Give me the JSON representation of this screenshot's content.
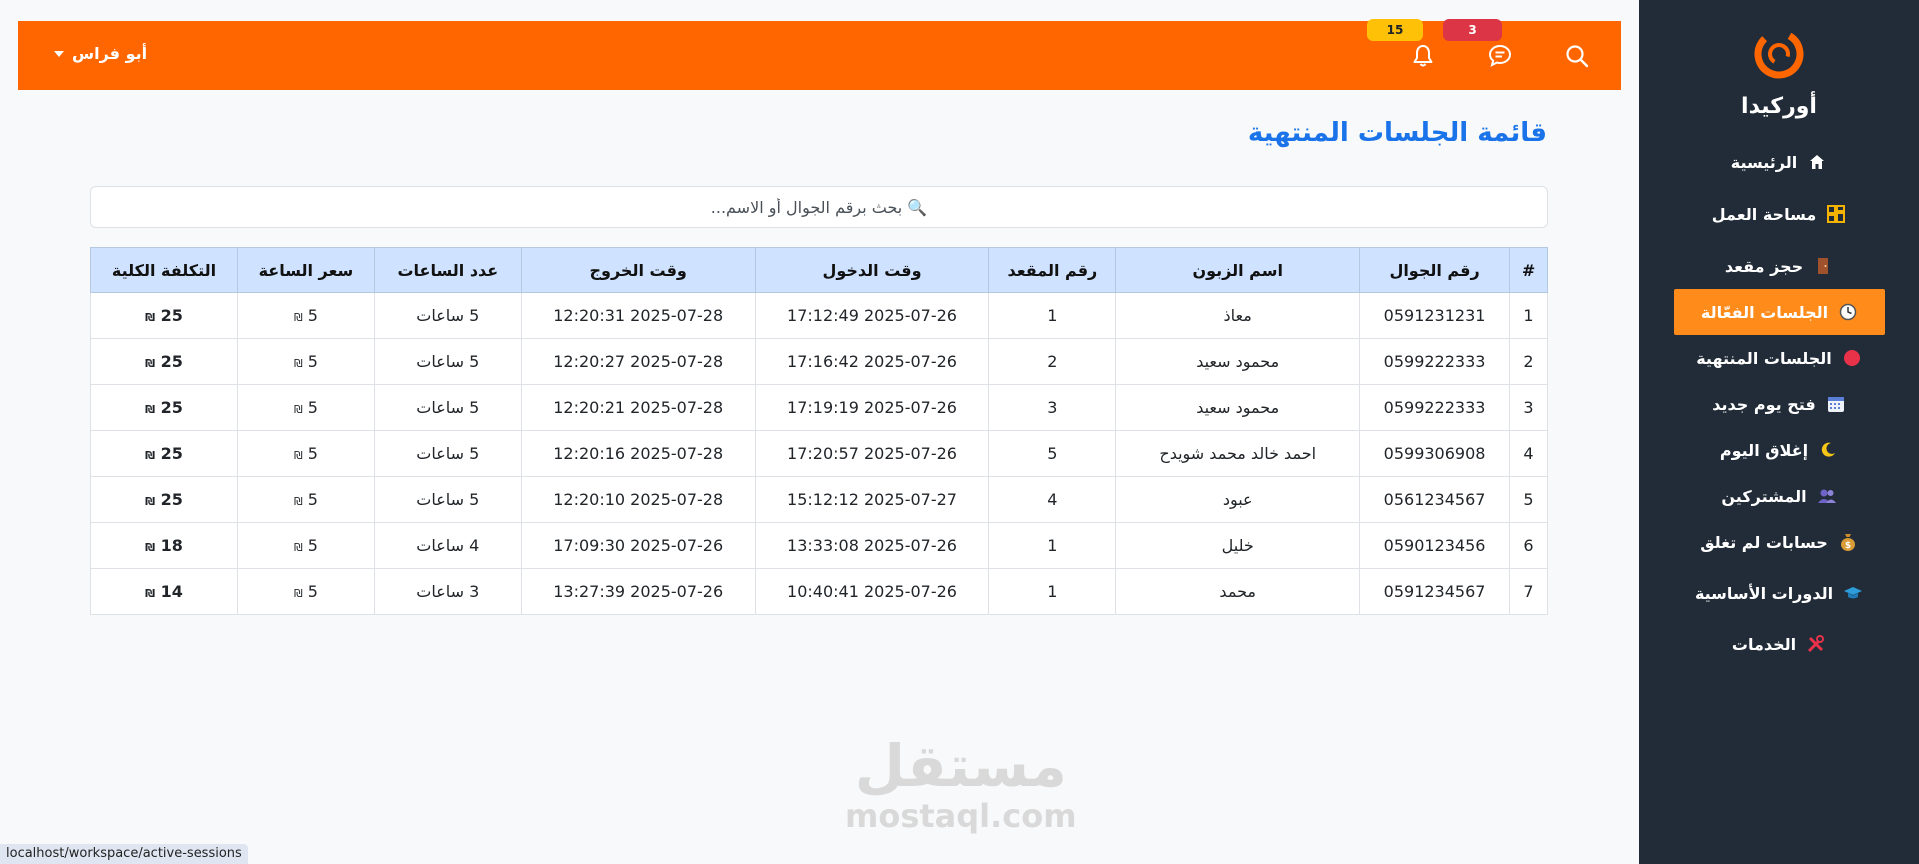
{
  "sidebar": {
    "brand": "أوركيدا",
    "items": [
      {
        "label": "الرئيسية",
        "icon": "home-icon"
      },
      {
        "label": "مساحة العمل",
        "icon": "workspace-icon"
      },
      {
        "label": "حجز مقعد",
        "icon": "door-icon"
      },
      {
        "label": "الجلسات الفعّالة",
        "icon": "clock-icon",
        "active": true
      },
      {
        "label": "الجلسات المنتهية",
        "icon": "red-circle-icon"
      },
      {
        "label": "فتح يوم جديد",
        "icon": "calendar-icon"
      },
      {
        "label": "إغلاق اليوم",
        "icon": "moon-icon"
      },
      {
        "label": "المشتركين",
        "icon": "users-icon"
      },
      {
        "label": "حسابات لم تغلق",
        "icon": "money-bag-icon"
      },
      {
        "label": "الدورات الأساسية",
        "icon": "graduation-cap-icon"
      },
      {
        "label": "الخدمات",
        "icon": "tools-icon"
      }
    ]
  },
  "topbar": {
    "user_name": "أبو فراس",
    "messages_count": "3",
    "notifications_count": "15"
  },
  "page_title": "قائمة الجلسات المنتهية",
  "search": {
    "placeholder": "🔍 بحث برقم الجوال أو الاسم..."
  },
  "table": {
    "headers": [
      "#",
      "رقم الجوال",
      "اسم الزبون",
      "رقم المقعد",
      "وقت الدخول",
      "وقت الخروج",
      "عدد الساعات",
      "سعر الساعة",
      "التكلفة الكلية"
    ],
    "rows": [
      [
        "1",
        "0591231231",
        "معاذ",
        "1",
        "2025-07-26 17:12:49",
        "2025-07-28 12:20:31",
        "5 ساعات",
        "5",
        "25"
      ],
      [
        "2",
        "0599222333",
        "محمود سعيد",
        "2",
        "2025-07-26 17:16:42",
        "2025-07-28 12:20:27",
        "5 ساعات",
        "5",
        "25"
      ],
      [
        "3",
        "0599222333",
        "محمود سعيد",
        "3",
        "2025-07-26 17:19:19",
        "2025-07-28 12:20:21",
        "5 ساعات",
        "5",
        "25"
      ],
      [
        "4",
        "0599306908",
        "احمد خالد محمد شويدح",
        "5",
        "2025-07-26 17:20:57",
        "2025-07-28 12:20:16",
        "5 ساعات",
        "5",
        "25"
      ],
      [
        "5",
        "0561234567",
        "عبود",
        "4",
        "2025-07-27 15:12:12",
        "2025-07-28 12:20:10",
        "5 ساعات",
        "5",
        "25"
      ],
      [
        "6",
        "0590123456",
        "خليل",
        "1",
        "2025-07-26 13:33:08",
        "2025-07-26 17:09:30",
        "4 ساعات",
        "5",
        "18"
      ],
      [
        "7",
        "0591234567",
        "محمد",
        "1",
        "2025-07-26 10:40:41",
        "2025-07-26 13:27:39",
        "3 ساعات",
        "5",
        "14"
      ]
    ],
    "currency": "₪"
  },
  "watermark": {
    "arabic": "مستقل",
    "english": "mostaql.com"
  },
  "status_url": "localhost/workspace/active-sessions",
  "colors": {
    "topbar": "#ff6600",
    "sidebar": "#212c38",
    "active": "#ff8c1a",
    "title": "#1a73e8",
    "cost": "#198754"
  }
}
